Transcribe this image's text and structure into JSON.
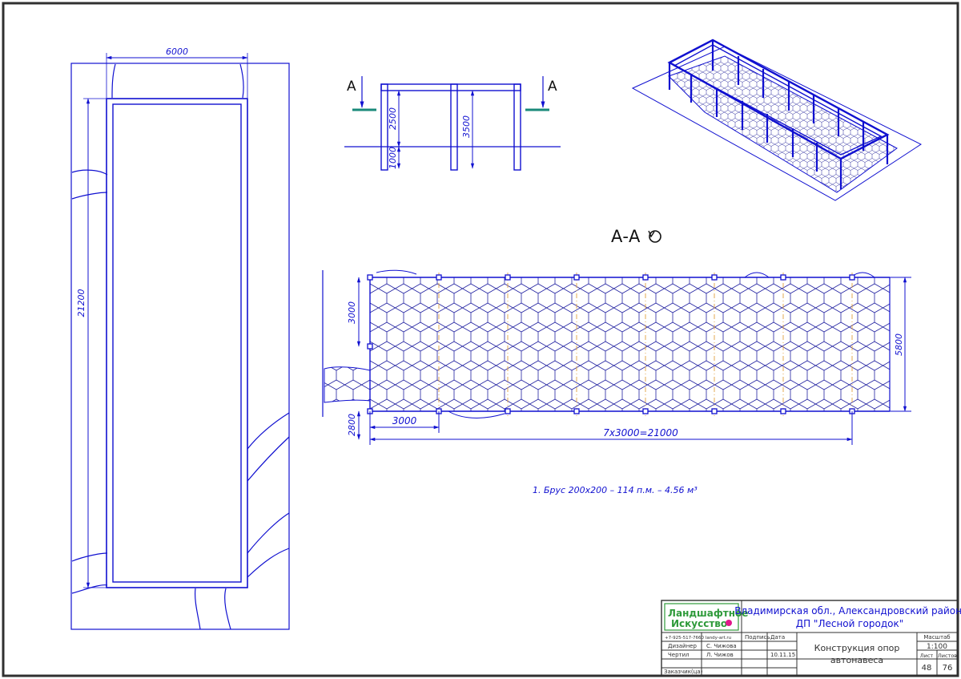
{
  "plan": {
    "dim_width": "6000",
    "dim_length": "21200"
  },
  "elevation": {
    "section_mark_left": "A",
    "section_mark_right": "A",
    "dim_height_upper": "2500",
    "dim_height_lower": "1000",
    "dim_height_total": "3500"
  },
  "section": {
    "title": "А-А",
    "dim_span_vertical": "3000",
    "dim_width": "5800",
    "dim_offset": "2800",
    "dim_bay": "3000",
    "dim_total_length": "7х3000=21000"
  },
  "spec_note": "1. Брус 200х200 – 114 п.м. – 4.56 м³",
  "title_block": {
    "logo_line1": "Ландшафтное",
    "logo_line2": "Искусство",
    "project_address_line1": "Владимирская обл., Александровский район,",
    "project_address_line2": "ДП \"Лесной городок\"",
    "contact_line": "+7-925-517-7660   landy-art.ru",
    "header_signature": "Подпись",
    "header_date": "Дата",
    "row1_role": "Дизайнер",
    "row1_name": "С. Чижова",
    "row2_role": "Чертил",
    "row2_name": "Л. Чижов",
    "row2_date": "10.11.15",
    "row3_role": "Заказчик(ца)",
    "drawing_title_line1": "Конструкция опор",
    "drawing_title_line2": "автонавеса",
    "scale_label": "Масштаб",
    "scale_value": "1:100",
    "sheet_label": "Лист",
    "sheets_label": "Листов",
    "sheet_number": "48",
    "sheets_total": "76"
  },
  "colors": {
    "line": "#1010d0",
    "frame": "#303030",
    "accent_section": "#1a8a7a",
    "axis": "#e0a040",
    "logo_green": "#2e9a3a",
    "logo_dot": "#e0188a"
  }
}
